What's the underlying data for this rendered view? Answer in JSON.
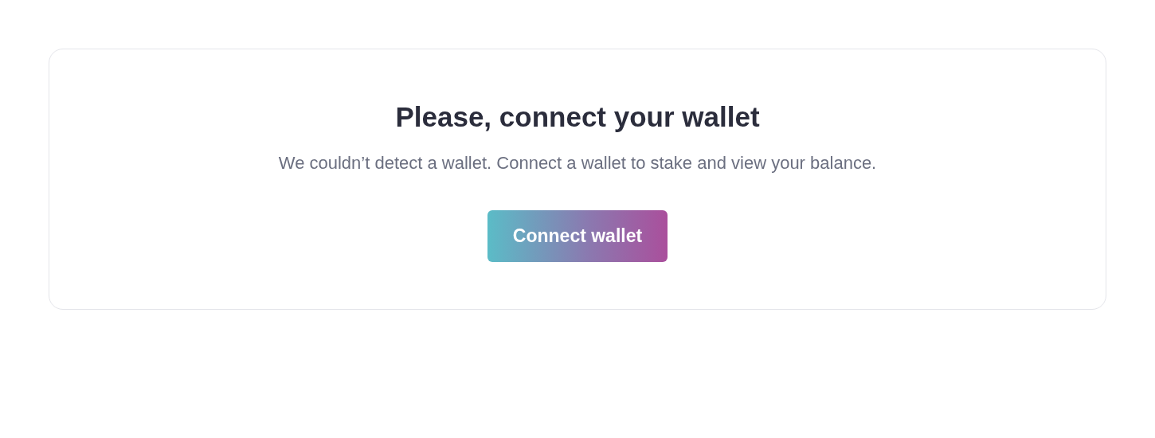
{
  "card": {
    "title": "Please, connect your wallet",
    "message": "We couldn’t detect a wallet. Connect a wallet to stake and view your balance.",
    "button": {
      "label": "Connect wallet"
    }
  }
}
